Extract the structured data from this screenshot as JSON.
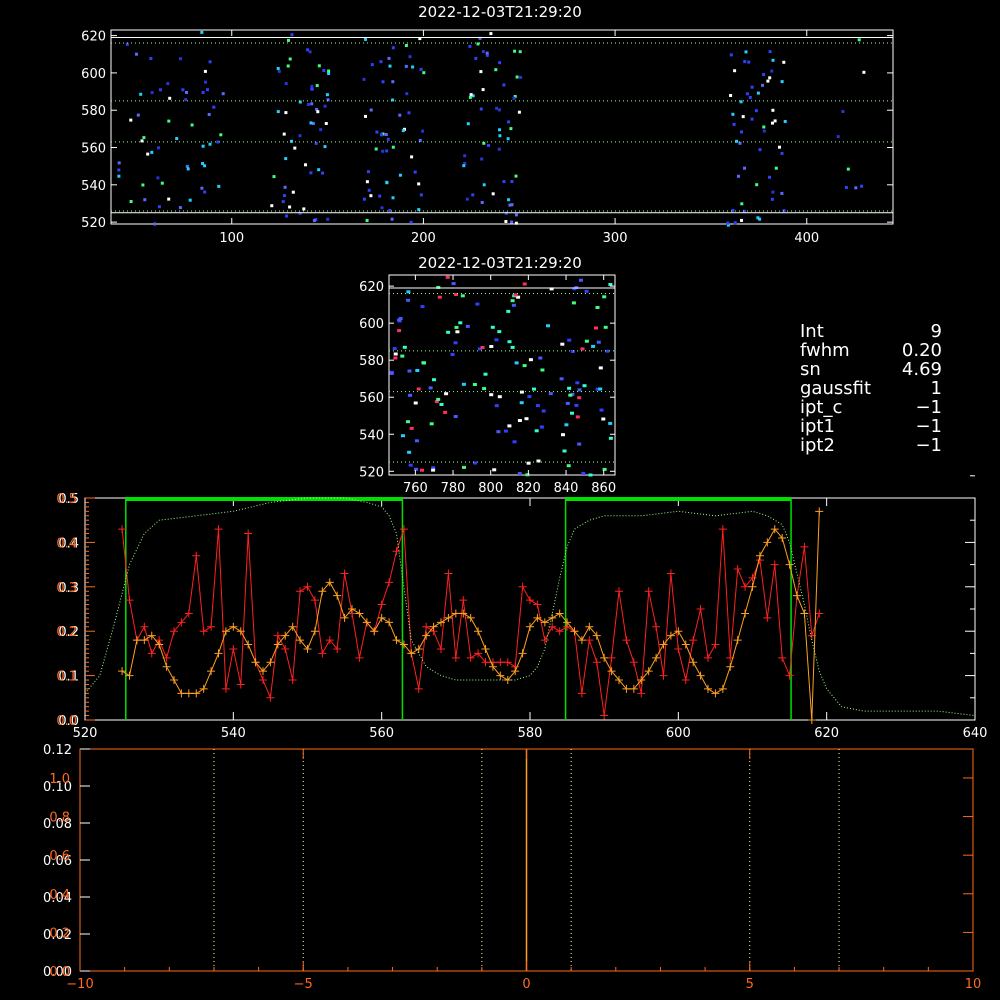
{
  "chart_data": [
    {
      "id": "top-image",
      "type": "heatmap",
      "title": "2022-12-03T21:29:20",
      "xlim": [
        37,
        445
      ],
      "ylim": [
        519,
        623
      ],
      "xticks": [
        100,
        200,
        300,
        400
      ],
      "yticks": [
        520,
        540,
        560,
        580,
        600,
        620
      ],
      "hlines_dotted": [
        526,
        563,
        585,
        616
      ],
      "hlines_solid": [
        525,
        619
      ],
      "band_x": [
        [
          40,
          95
        ],
        [
          120,
          150
        ],
        [
          168,
          200
        ],
        [
          220,
          250
        ],
        [
          358,
          390
        ],
        [
          415,
          430
        ]
      ]
    },
    {
      "id": "zoom-image",
      "type": "heatmap",
      "title": "2022-12-03T21:29:20",
      "xlim": [
        746,
        866
      ],
      "ylim": [
        518,
        626
      ],
      "xticks": [
        760,
        780,
        800,
        820,
        840,
        860
      ],
      "yticks": [
        520,
        540,
        560,
        580,
        600,
        620
      ],
      "hlines_dotted": [
        525,
        563,
        585,
        616
      ],
      "hlines_solid": [
        619
      ]
    },
    {
      "id": "profile-plot",
      "type": "line",
      "xlim": [
        520,
        640
      ],
      "ylim": [
        0,
        0.5
      ],
      "xticks": [
        520,
        540,
        560,
        580,
        600,
        620,
        640
      ],
      "yticks": [
        "0.0",
        "0.1",
        "0.2",
        "0.3",
        "0.4",
        "0.5"
      ],
      "windows": [
        [
          525.5,
          562.8
        ],
        [
          584.8,
          615.2
        ]
      ],
      "series": [
        {
          "color": "#ff2020",
          "marker": "plus",
          "x": [
            525,
            526,
            527,
            528,
            529,
            530,
            531,
            532,
            533,
            534,
            535,
            536,
            537,
            538,
            539,
            540,
            541,
            542,
            543,
            544,
            545,
            546,
            547,
            548,
            549,
            550,
            551,
            552,
            553,
            554,
            555,
            556,
            557,
            558,
            559,
            560,
            561,
            562,
            563,
            564,
            565,
            566,
            567,
            568,
            569,
            570,
            571,
            572,
            573,
            574,
            575,
            576,
            577,
            578,
            579,
            580,
            581,
            582,
            583,
            584,
            585,
            586,
            587,
            588,
            589,
            590,
            591,
            592,
            593,
            594,
            595,
            596,
            597,
            598,
            599,
            600,
            601,
            602,
            603,
            604,
            605,
            606,
            607,
            608,
            609,
            610,
            611,
            612,
            613,
            614,
            615,
            616,
            617,
            618,
            619
          ],
          "y": [
            0.43,
            0.27,
            0.18,
            0.21,
            0.15,
            0.18,
            0.14,
            0.2,
            0.22,
            0.24,
            0.37,
            0.2,
            0.21,
            0.43,
            0.07,
            0.16,
            0.08,
            0.42,
            0.13,
            0.09,
            0.05,
            0.19,
            0.16,
            0.09,
            0.29,
            0.3,
            0.27,
            0.15,
            0.18,
            0.16,
            0.33,
            0.24,
            0.14,
            0.22,
            0.2,
            0.26,
            0.31,
            0.38,
            0.43,
            0.15,
            0.07,
            0.21,
            0.2,
            0.16,
            0.33,
            0.14,
            0.27,
            0.14,
            0.15,
            0.13,
            0.13,
            0.13,
            0.13,
            0.12,
            0.3,
            0.27,
            0.26,
            0.18,
            0.21,
            0.2,
            0.21,
            0.2,
            0.06,
            0.18,
            0.13,
            0.01,
            0.14,
            0.29,
            0.18,
            0.13,
            0.06,
            0.29,
            0.21,
            0.1,
            0.33,
            0.16,
            0.09,
            0.18,
            0.25,
            0.14,
            0.17,
            0.43,
            0.14,
            0.34,
            0.3,
            0.32,
            0.36,
            0.23,
            0.35,
            0.14,
            0.1,
            0.28,
            0.39,
            0.19,
            0.24
          ]
        },
        {
          "color": "#ffa020",
          "marker": "plus",
          "x": [
            525,
            526,
            527,
            528,
            529,
            530,
            531,
            532,
            533,
            534,
            535,
            536,
            537,
            538,
            539,
            540,
            541,
            542,
            543,
            544,
            545,
            546,
            547,
            548,
            549,
            550,
            551,
            552,
            553,
            554,
            555,
            556,
            557,
            558,
            559,
            560,
            561,
            562,
            563,
            564,
            565,
            566,
            567,
            568,
            569,
            570,
            571,
            572,
            573,
            574,
            575,
            576,
            577,
            578,
            579,
            580,
            581,
            582,
            583,
            584,
            585,
            586,
            587,
            588,
            589,
            590,
            591,
            592,
            593,
            594,
            595,
            596,
            597,
            598,
            599,
            600,
            601,
            602,
            603,
            604,
            605,
            606,
            607,
            608,
            609,
            610,
            611,
            612,
            613,
            614,
            615,
            616,
            617,
            618,
            619
          ],
          "y": [
            0.11,
            0.1,
            0.18,
            0.18,
            0.19,
            0.17,
            0.12,
            0.09,
            0.06,
            0.06,
            0.06,
            0.07,
            0.11,
            0.15,
            0.2,
            0.21,
            0.2,
            0.17,
            0.13,
            0.11,
            0.13,
            0.17,
            0.19,
            0.21,
            0.18,
            0.16,
            0.2,
            0.29,
            0.31,
            0.28,
            0.23,
            0.25,
            0.24,
            0.22,
            0.2,
            0.23,
            0.22,
            0.18,
            0.17,
            0.15,
            0.16,
            0.19,
            0.21,
            0.22,
            0.23,
            0.24,
            0.24,
            0.23,
            0.2,
            0.16,
            0.12,
            0.1,
            0.09,
            0.11,
            0.15,
            0.21,
            0.23,
            0.22,
            0.23,
            0.24,
            0.22,
            0.2,
            0.18,
            0.21,
            0.19,
            0.14,
            0.11,
            0.09,
            0.07,
            0.07,
            0.09,
            0.11,
            0.14,
            0.17,
            0.19,
            0.2,
            0.17,
            0.13,
            0.1,
            0.07,
            0.06,
            0.07,
            0.12,
            0.18,
            0.24,
            0.3,
            0.37,
            0.4,
            0.43,
            0.41,
            0.35,
            0.28,
            0.24,
            0.0,
            0.47
          ]
        },
        {
          "color": "#a0ff80",
          "dotted": true,
          "x": [
            520,
            522,
            524,
            526,
            528,
            530,
            535,
            540,
            545,
            550,
            555,
            558,
            560,
            561,
            562,
            563,
            564,
            566,
            568,
            570,
            574,
            578,
            580,
            581,
            582,
            583,
            584,
            585,
            586,
            588,
            590,
            595,
            600,
            605,
            610,
            612,
            614,
            615,
            616,
            617,
            618,
            619,
            620,
            622,
            625,
            630,
            635,
            640
          ],
          "y": [
            0.06,
            0.1,
            0.22,
            0.35,
            0.42,
            0.45,
            0.46,
            0.47,
            0.49,
            0.5,
            0.5,
            0.49,
            0.48,
            0.46,
            0.42,
            0.3,
            0.18,
            0.12,
            0.1,
            0.09,
            0.09,
            0.09,
            0.1,
            0.12,
            0.16,
            0.24,
            0.32,
            0.39,
            0.43,
            0.45,
            0.46,
            0.46,
            0.47,
            0.46,
            0.47,
            0.46,
            0.44,
            0.4,
            0.33,
            0.26,
            0.18,
            0.11,
            0.07,
            0.03,
            0.02,
            0.02,
            0.02,
            0.01
          ]
        }
      ]
    },
    {
      "id": "histogram-plot",
      "type": "line",
      "xlim": [
        -10,
        10
      ],
      "ylim": [
        0,
        0.12
      ],
      "xticks": [
        "−10",
        "−5",
        "0",
        "5",
        "10"
      ],
      "yticks": [
        "0.00",
        "0.02",
        "0.04",
        "0.06",
        "0.08",
        "0.10",
        "0.12"
      ],
      "yticks_right_overlay": [
        "0.0",
        "0.2",
        "0.4",
        "0.6",
        "0.8",
        "1.0"
      ],
      "vlines_dotted": [
        -7,
        -5,
        -1,
        1,
        5,
        7
      ],
      "vline_solid": 0
    }
  ],
  "info_panel": {
    "rows": [
      {
        "key": "Int",
        "value": "9"
      },
      {
        "key": "fwhm",
        "value": "0.20"
      },
      {
        "key": "sn",
        "value": "4.69"
      },
      {
        "key": "gaussfit",
        "value": "1"
      },
      {
        "key": "ipt_c",
        "value": "−1"
      },
      {
        "key": "ipt1",
        "value": "−1"
      },
      {
        "key": "ipt2",
        "value": "−1"
      }
    ]
  },
  "colors": {
    "axes_white": "#ffffff",
    "axes_orange": "#ff6a1e",
    "dotted_green": "#9cff90",
    "window_green": "#00e000",
    "pixel_blue": "#3040ff",
    "pixel_cyan": "#20d0ff",
    "pixel_green": "#40ff80"
  }
}
